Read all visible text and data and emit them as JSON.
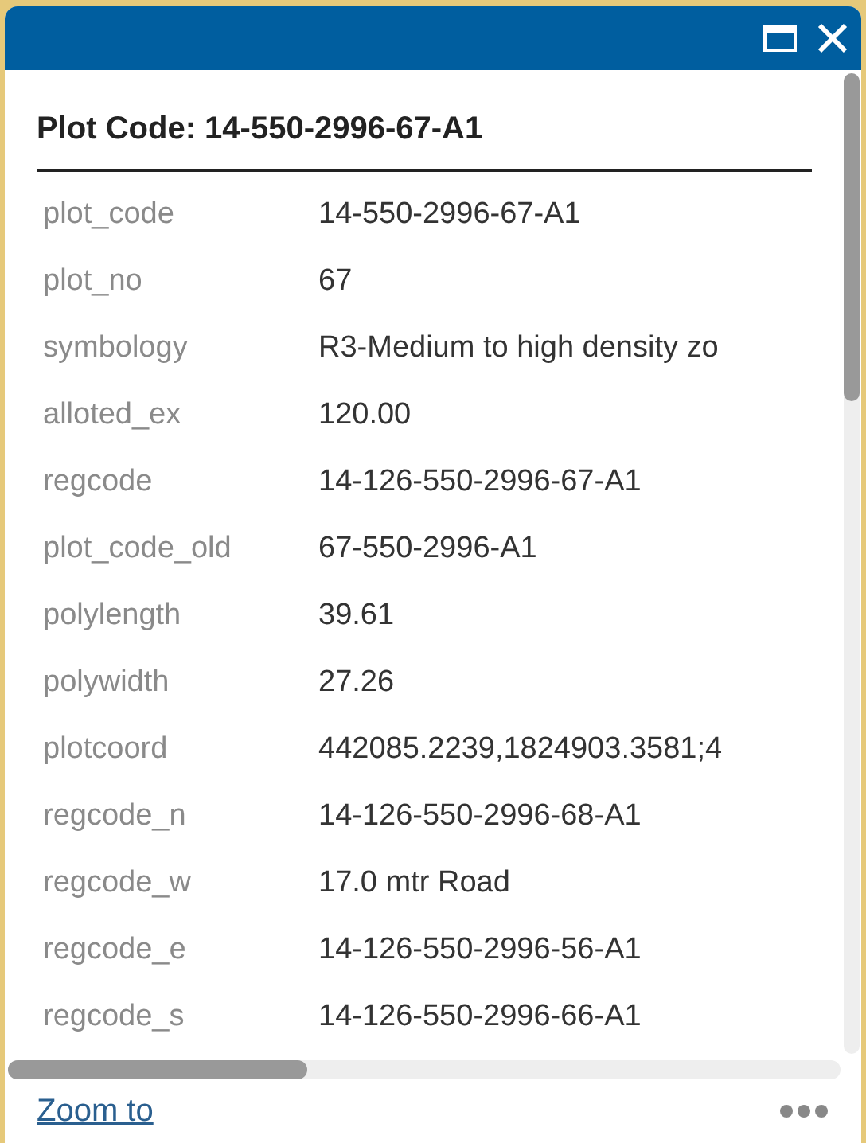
{
  "popup": {
    "title": "Plot Code: 14-550-2996-67-A1"
  },
  "fields": [
    {
      "label": "plot_code",
      "value": "14-550-2996-67-A1"
    },
    {
      "label": "plot_no",
      "value": "67"
    },
    {
      "label": "symbology",
      "value": "R3-Medium to high density zo"
    },
    {
      "label": "alloted_ex",
      "value": "120.00"
    },
    {
      "label": "regcode",
      "value": "14-126-550-2996-67-A1"
    },
    {
      "label": "plot_code_old",
      "value": "67-550-2996-A1"
    },
    {
      "label": "polylength",
      "value": "39.61"
    },
    {
      "label": "polywidth",
      "value": "27.26"
    },
    {
      "label": "plotcoord",
      "value": "442085.2239,1824903.3581;4"
    },
    {
      "label": "regcode_n",
      "value": "14-126-550-2996-68-A1"
    },
    {
      "label": "regcode_w",
      "value": "17.0 mtr Road"
    },
    {
      "label": "regcode_e",
      "value": "14-126-550-2996-56-A1"
    },
    {
      "label": "regcode_s",
      "value": "14-126-550-2996-66-A1"
    }
  ],
  "footer": {
    "link": "Zoom to"
  }
}
